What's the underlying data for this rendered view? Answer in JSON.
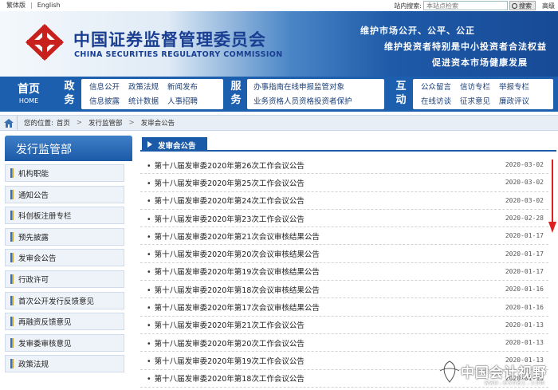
{
  "topbar": {
    "lang_traditional": "繁体版",
    "lang_english": "English",
    "search_label": "站内搜索:",
    "search_placeholder": "本站点检索",
    "search_button": "搜索",
    "advanced": "高级"
  },
  "brand": {
    "name_cn": "中国证券监督管理委员会",
    "name_en": "CHINA SECURITIES REGULATORY COMMISSION",
    "slogan_1": "维护市场公开、公平、公正",
    "slogan_2": "维护投资者特别是中小投资者合法权益",
    "slogan_3": "促进资本市场健康发展",
    "logo_color": "#c8201c",
    "brand_color": "#1a3f92"
  },
  "nav": {
    "home_cn": "首页",
    "home_en": "HOME",
    "group_zhengwu": "政务",
    "group_fuwu": "服务",
    "group_hudong": "互动",
    "zhengwu_items": [
      [
        "信息公开",
        "政策法规",
        "新闻发布"
      ],
      [
        "信息披露",
        "统计数据",
        "人事招聘"
      ]
    ],
    "fuwu_items": [
      [
        "办事指南",
        "在线申报",
        "监管对象"
      ],
      [
        "业务资格",
        "人员资格",
        "投资者保护"
      ]
    ],
    "hudong_items": [
      [
        "公众留言",
        "信访专栏",
        "举报专栏"
      ],
      [
        "在线访谈",
        "征求意见",
        "廉政评议"
      ]
    ]
  },
  "breadcrumb": {
    "prefix": "您的位置:",
    "items": [
      "首页",
      "发行监管部",
      "发审会公告"
    ]
  },
  "sidebar": {
    "title": "发行监管部",
    "items": [
      "机构职能",
      "通知公告",
      "科创板注册专栏",
      "预先披露",
      "发审会公告",
      "行政许可",
      "首次公开发行反馈意见",
      "再融资反馈意见",
      "发审委审核意见",
      "政策法规"
    ]
  },
  "main": {
    "tab": "发审会公告",
    "rows": [
      {
        "title": "第十八届发审委2020年第26次工作会议公告",
        "date": "2020-03-02"
      },
      {
        "title": "第十八届发审委2020年第25次工作会议公告",
        "date": "2020-03-02"
      },
      {
        "title": "第十八届发审委2020年第24次工作会议公告",
        "date": "2020-03-02"
      },
      {
        "title": "第十八届发审委2020年第23次工作会议公告",
        "date": "2020-02-28"
      },
      {
        "title": "第十八届发审委2020年第21次会议审核结果公告",
        "date": "2020-01-17"
      },
      {
        "title": "第十八届发审委2020年第20次会议审核结果公告",
        "date": "2020-01-17"
      },
      {
        "title": "第十八届发审委2020年第19次会议审核结果公告",
        "date": "2020-01-17"
      },
      {
        "title": "第十八届发审委2020年第18次会议审核结果公告",
        "date": "2020-01-16"
      },
      {
        "title": "第十八届发审委2020年第17次会议审核结果公告",
        "date": "2020-01-16"
      },
      {
        "title": "第十八届发审委2020年第21次工作会议公告",
        "date": "2020-01-13"
      },
      {
        "title": "第十八届发审委2020年第20次工作会议公告",
        "date": "2020-01-13"
      },
      {
        "title": "第十八届发审委2020年第19次工作会议公告",
        "date": "2020-01-13"
      },
      {
        "title": "第十八届发审委2020年第18次工作会议公告",
        "date": "2020-01-13"
      }
    ]
  },
  "annotation": {
    "arrow_color": "#e02020"
  },
  "watermark": {
    "cn": "中国会计视野",
    "en": "www.esnai.com"
  }
}
